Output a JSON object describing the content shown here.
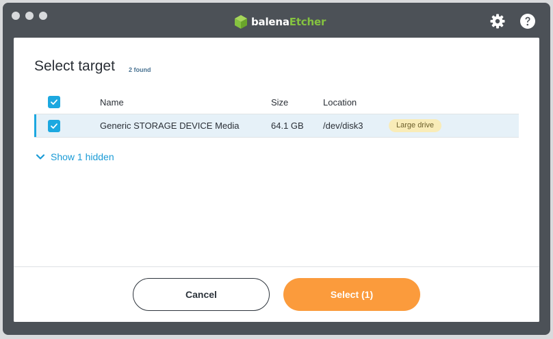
{
  "app": {
    "brand_prefix": "balena",
    "brand_suffix": "Etcher",
    "brand_color": "#85c340"
  },
  "modal": {
    "title": "Select target",
    "found_count": "2 found",
    "columns": {
      "name": "Name",
      "size": "Size",
      "location": "Location"
    },
    "drives": [
      {
        "name": "Generic STORAGE DEVICE Media",
        "size": "64.1 GB",
        "location": "/dev/disk3",
        "badge": "Large drive",
        "selected": true
      }
    ],
    "show_hidden": "Show 1 hidden",
    "cancel_label": "Cancel",
    "select_label": "Select (1)"
  },
  "colors": {
    "accent": "#1ca8e0",
    "primary_button": "#fb9b3c",
    "badge_bg": "#f9ecb8"
  },
  "icons": [
    "settings-gear-icon",
    "help-question-icon",
    "check-icon",
    "chevron-down-icon"
  ]
}
